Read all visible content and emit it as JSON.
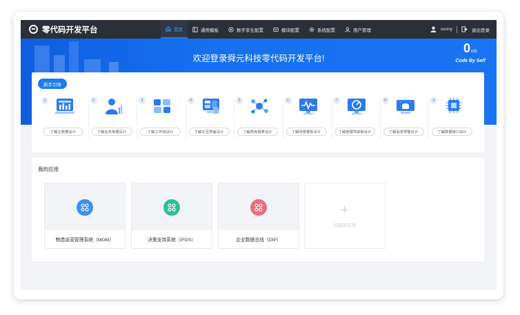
{
  "app": {
    "title": "零代码开发平台"
  },
  "nav": {
    "items": [
      {
        "label": "首页",
        "icon": "home-icon"
      },
      {
        "label": "通用模板",
        "icon": "template-icon"
      },
      {
        "label": "数字孪生配置",
        "icon": "twin-icon"
      },
      {
        "label": "模块配置",
        "icon": "module-icon"
      },
      {
        "label": "系统配置",
        "icon": "gear-icon"
      },
      {
        "label": "用户管理",
        "icon": "user-icon"
      }
    ]
  },
  "user": {
    "name": "sunny",
    "logout_label": "退出登录"
  },
  "banner": {
    "title": "欢迎登录舜元科技零代码开发平台!",
    "logo_mark": "0",
    "logo_sub": "元科",
    "tagline": "Code By Self"
  },
  "guide": {
    "button_label": "新手引导",
    "steps": [
      {
        "num": "1",
        "label": "了解主数据设计",
        "icon": "dashboard-icon"
      },
      {
        "num": "2",
        "label": "了解业务单据设计",
        "icon": "person-chart-icon"
      },
      {
        "num": "3",
        "label": "了解工作流设计",
        "icon": "workflow-icon"
      },
      {
        "num": "4",
        "label": "了解交互界面设计",
        "icon": "interface-icon"
      },
      {
        "num": "5",
        "label": "了解角色报表设计",
        "icon": "network-icon"
      },
      {
        "num": "6",
        "label": "了解场景看板设计",
        "icon": "monitor-chart-icon"
      },
      {
        "num": "7",
        "label": "了解管理驾驶舱设计",
        "icon": "cockpit-icon"
      },
      {
        "num": "8",
        "label": "了解消息预警设计",
        "icon": "alarm-icon"
      },
      {
        "num": "9",
        "label": "了解数据接口设计",
        "icon": "chip-icon"
      }
    ]
  },
  "apps": {
    "title": "我的应用",
    "items": [
      {
        "name": "制造运营管理系统（MOM）",
        "color": "#3d8ef0"
      },
      {
        "name": "决策支持系统（IFDS）",
        "color": "#2fbf93"
      },
      {
        "name": "企业数据总线（DIP）",
        "color": "#f06a7d"
      }
    ],
    "new_label": "创建新应用"
  },
  "colors": {
    "primary": "#1f7cf0",
    "topbar": "#2b2f38",
    "banner": "#1670f0"
  }
}
